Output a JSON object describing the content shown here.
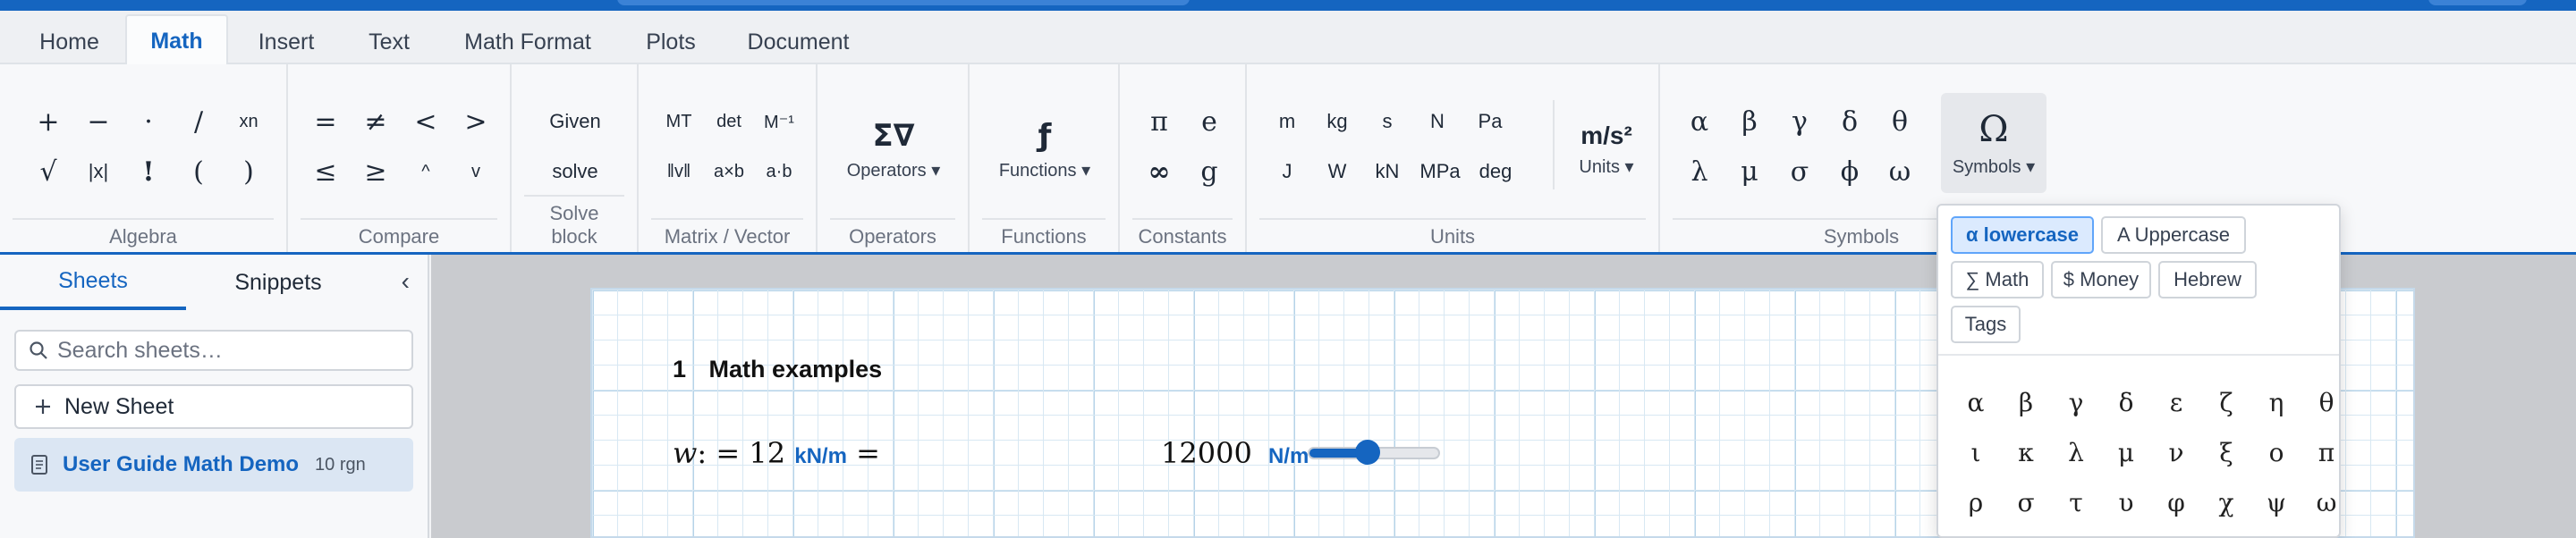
{
  "tabs": [
    "Home",
    "Math",
    "Insert",
    "Text",
    "Math Format",
    "Plots",
    "Document"
  ],
  "ribbon": {
    "algebra": {
      "label": "Algebra",
      "row1": [
        "+",
        "−",
        "·",
        "/",
        "xn"
      ],
      "row2": [
        "√",
        "|x|",
        "!",
        "(",
        ")"
      ]
    },
    "compare": {
      "label": "Compare",
      "row1": [
        "=",
        "≠",
        "<",
        ">"
      ],
      "row2": [
        "≤",
        "≥",
        "^",
        "v"
      ]
    },
    "solve": {
      "label": "Solve block",
      "given": "Given",
      "solve": "solve"
    },
    "matrix": {
      "label": "Matrix / Vector",
      "row1": [
        "MT",
        "det",
        "M⁻¹"
      ],
      "row2": [
        "‖v‖",
        "a×b",
        "a·b"
      ]
    },
    "operators": {
      "label": "Operators",
      "glyph": "Σ∇",
      "button": "Operators ▾"
    },
    "functions": {
      "label": "Functions",
      "glyph": "ƒ",
      "button": "Functions ▾"
    },
    "constants": {
      "label": "Constants",
      "row1": [
        "π",
        "e"
      ],
      "row2": [
        "∞",
        "g"
      ]
    },
    "units": {
      "label": "Units",
      "row1": [
        "m",
        "kg",
        "s",
        "N",
        "Pa"
      ],
      "row2": [
        "J",
        "W",
        "kN",
        "MPa",
        "deg"
      ],
      "big": "m/s²",
      "button": "Units ▾"
    },
    "symbols": {
      "label": "Symbols",
      "row1": [
        "α",
        "β",
        "γ",
        "δ",
        "θ"
      ],
      "row2": [
        "λ",
        "μ",
        "σ",
        "ϕ",
        "ω"
      ],
      "big": "Ω",
      "button": "Symbols ▾"
    }
  },
  "sidebar": {
    "tabs": [
      "Sheets",
      "Snippets"
    ],
    "collapse_glyph": "‹",
    "search_placeholder": "Search sheets…",
    "new_sheet": "New Sheet",
    "sheet": {
      "name": "User Guide Math Demo",
      "count": "10 rgn"
    }
  },
  "worksheet": {
    "heading_num": "1",
    "heading": "Math examples",
    "expr_var": "w",
    "expr_def": ": = 12",
    "expr_unit": "kN/m",
    "expr_eq": "=",
    "result_val": "12000",
    "result_unit": "N/m",
    "slider_fraction": 0.45
  },
  "symbol_dropdown": {
    "categories": [
      "α lowercase",
      "A Uppercase",
      "∑ Math",
      "$ Money",
      "Hebrew",
      "Tags"
    ],
    "active_category": "α lowercase",
    "glyphs": [
      [
        "α",
        "β",
        "γ",
        "δ",
        "ε",
        "ζ",
        "η",
        "θ"
      ],
      [
        "ι",
        "κ",
        "λ",
        "μ",
        "ν",
        "ξ",
        "ο",
        "π"
      ],
      [
        "ρ",
        "σ",
        "τ",
        "υ",
        "φ",
        "χ",
        "ψ",
        "ω"
      ]
    ]
  },
  "colors": {
    "accent": "#1565c0",
    "topbar": "#1565c0"
  }
}
